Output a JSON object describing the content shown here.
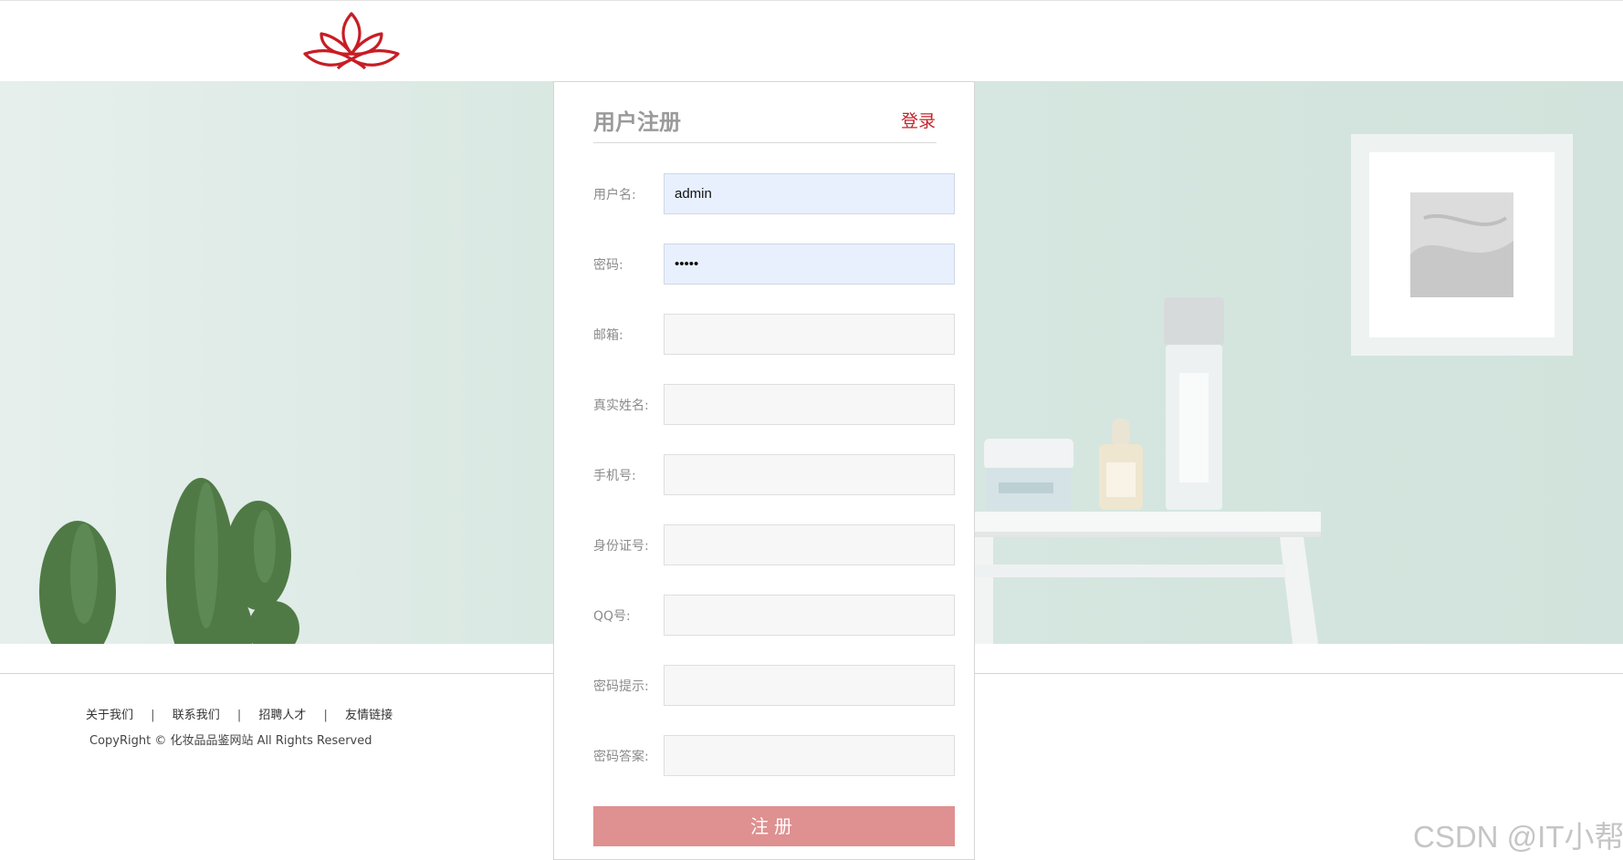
{
  "register": {
    "title": "用户注册",
    "login_link": "登录",
    "fields": [
      {
        "label": "用户名:",
        "value": "admin"
      },
      {
        "label": "密码:",
        "value": "•••••"
      },
      {
        "label": "邮箱:",
        "value": ""
      },
      {
        "label": "真实姓名:",
        "value": ""
      },
      {
        "label": "手机号:",
        "value": ""
      },
      {
        "label": "身份证号:",
        "value": ""
      },
      {
        "label": "QQ号:",
        "value": ""
      },
      {
        "label": "密码提示:",
        "value": ""
      },
      {
        "label": "密码答案:",
        "value": ""
      }
    ],
    "submit_label": "注册"
  },
  "footer": {
    "links": [
      "关于我们",
      "联系我们",
      "招聘人才",
      "友情链接"
    ],
    "separator": "|",
    "copyright": "CopyRight © 化妆品品鉴网站 All Rights Reserved"
  },
  "watermark": "CSDN @IT小帮",
  "colors": {
    "brand_red": "#c0242b",
    "submit_button": "#df9090",
    "banner_mint": "#d6e6e0"
  },
  "icons": {
    "logo": "lotus-logo-icon"
  }
}
